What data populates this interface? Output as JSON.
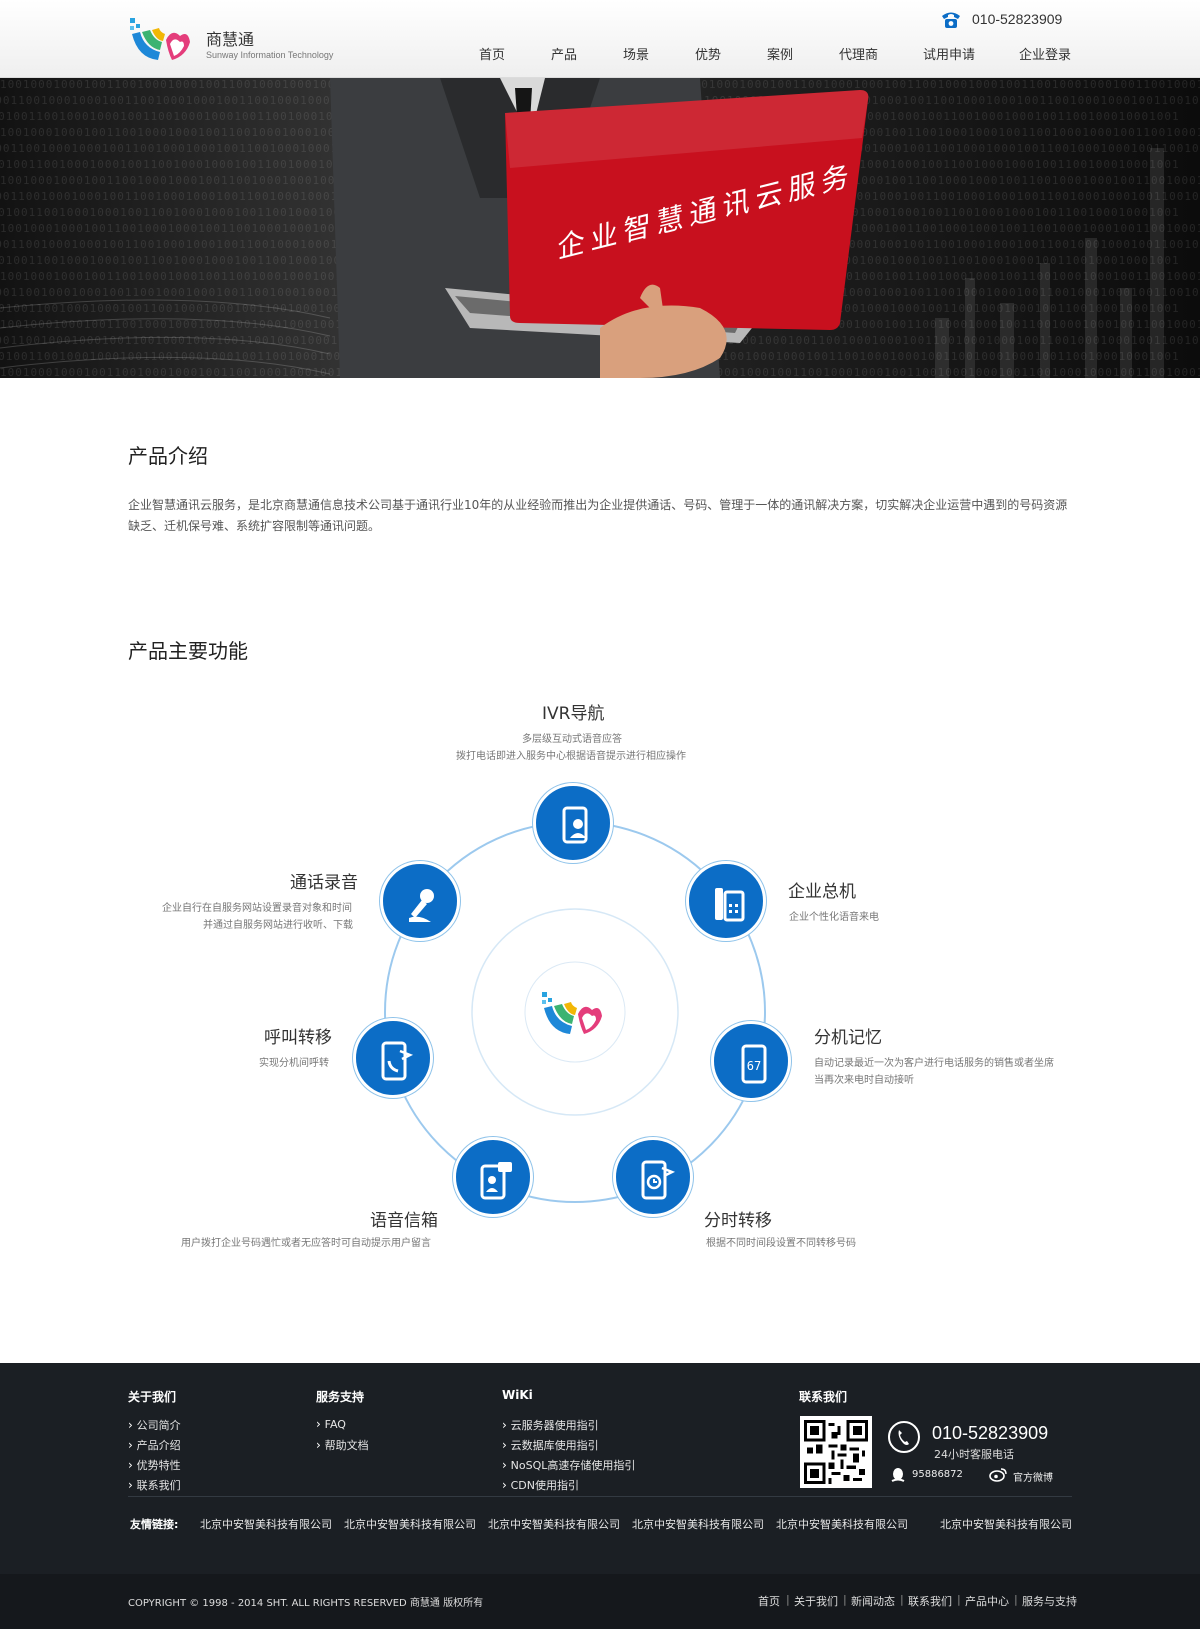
{
  "header": {
    "logo_name": "商慧通",
    "logo_sub": "Sunway Information Technology",
    "phone": "010-52823909",
    "nav": [
      "首页",
      "产品",
      "场景",
      "优势",
      "案例",
      "代理商",
      "试用申请",
      "企业登录"
    ]
  },
  "banner": {
    "slogan": "企业智慧通讯云服务"
  },
  "intro": {
    "title": "产品介绍",
    "text": "企业智慧通讯云服务，是北京商慧通信息技术公司基于通讯行业10年的从业经验而推出为企业提供通话、号码、管理于一体的通讯解决方案，切实解决企业运营中遇到的号码资源缺乏、迁机保号难、系统扩容限制等通讯问题。"
  },
  "features": {
    "title": "产品主要功能",
    "items": [
      {
        "title": "IVR导航",
        "desc": [
          "多层级互动式语音应答",
          "拨打电话即进入服务中心根据语音提示进行相应操作"
        ],
        "icon": "phone-person-icon"
      },
      {
        "title": "企业总机",
        "desc": [
          "企业个性化语音来电"
        ],
        "icon": "desk-phone-icon"
      },
      {
        "title": "分机记忆",
        "desc": [
          "自动记录最近一次为客户进行电话服务的销售或者坐席",
          "当再次来电时自动接听"
        ],
        "icon": "phone-memory-icon"
      },
      {
        "title": "分时转移",
        "desc": [
          "根据不同时间段设置不同转移号码"
        ],
        "icon": "phone-clock-icon"
      },
      {
        "title": "语音信箱",
        "desc": [
          "用户拨打企业号码遇忙或者无应答时可自动提示用户留言"
        ],
        "icon": "voicemail-icon"
      },
      {
        "title": "呼叫转移",
        "desc": [
          "实现分机间呼转"
        ],
        "icon": "call-forward-icon"
      },
      {
        "title": "通话录音",
        "desc": [
          "企业自行在自服务网站设置录音对象和时间",
          "并通过自服务网站进行收听、下载"
        ],
        "icon": "microphone-icon"
      }
    ]
  },
  "footer": {
    "columns": [
      {
        "title": "关于我们",
        "links": [
          "公司简介",
          "产品介绍",
          "优势特性",
          "联系我们"
        ]
      },
      {
        "title": "服务支持",
        "links": [
          "FAQ",
          "帮助文档"
        ]
      },
      {
        "title": "WiKi",
        "links": [
          "云服务器使用指引",
          "云数据库使用指引",
          "NoSQL高速存储使用指引",
          "CDN使用指引"
        ]
      }
    ],
    "contact": {
      "title": "联系我们",
      "phone": "010-52823909",
      "phone_note": "24小时客服电话",
      "qq": "95886872",
      "weibo": "官方微博"
    },
    "friend_label": "友情链接:",
    "friend_links": [
      "北京中安智美科技有限公司",
      "北京中安智美科技有限公司",
      "北京中安智美科技有限公司",
      "北京中安智美科技有限公司",
      "北京中安智美科技有限公司",
      "北京中安智美科技有限公司"
    ],
    "copyright": "COPYRIGHT © 1998 - 2014 SHT. ALL RIGHTS RESERVED  商慧通 版权所有",
    "bottom_nav": [
      "首页",
      "关于我们",
      "新闻动态",
      "联系我们",
      "产品中心",
      "服务与支持"
    ]
  },
  "colors": {
    "accent_blue": "#0c6dc6",
    "footer_bg": "#1b1f24",
    "laptop_red": "#c8101e"
  }
}
